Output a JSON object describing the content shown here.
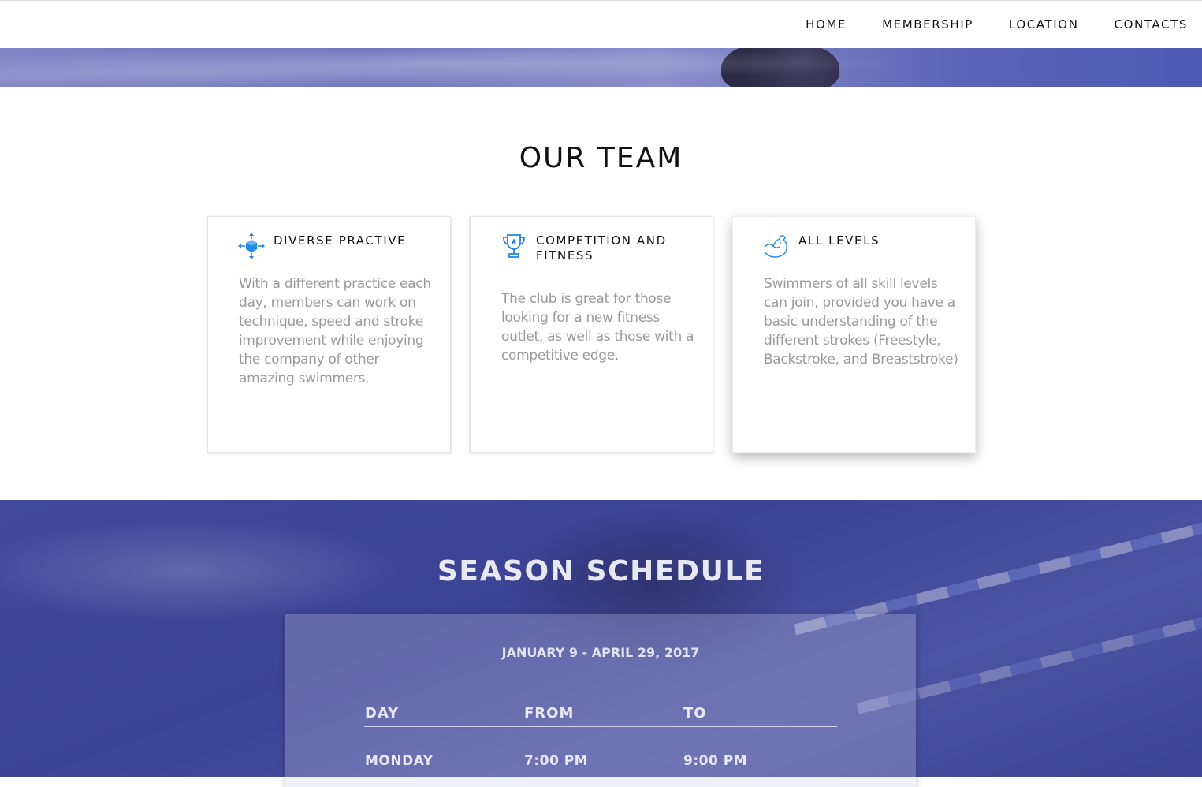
{
  "nav": {
    "items": [
      {
        "label": "HOME"
      },
      {
        "label": "MEMBERSHIP"
      },
      {
        "label": "LOCATION"
      },
      {
        "label": "CONTACTS"
      }
    ]
  },
  "team": {
    "title": "OUR TEAM",
    "cards": [
      {
        "icon": "cube-arrows-icon",
        "title": "DIVERSE PRACTIVE",
        "text": "With a different practice each day, members can work on technique, speed and stroke improvement while enjoying the company of other amazing swimmers."
      },
      {
        "icon": "trophy-icon",
        "title": "COMPETITION AND FITNESS",
        "text": "The club is great for those looking for a new fitness outlet, as well as those with a competitive edge."
      },
      {
        "icon": "flexed-arm-icon",
        "title": "ALL LEVELS",
        "text": "Swimmers of all skill levels can join, provided you have a basic understanding of the different strokes (Freestyle, Backstroke, and Breaststroke)"
      }
    ]
  },
  "schedule": {
    "title": "SEASON SCHEDULE",
    "dates": "JANUARY 9 - APRIL 29, 2017",
    "headers": {
      "day": "DAY",
      "from": "FROM",
      "to": "TO"
    },
    "rows": [
      {
        "day": "MONDAY",
        "from": "7:00 PM",
        "to": "9:00 PM"
      }
    ]
  },
  "colors": {
    "accent": "#1e88e5",
    "schedule_bg": "#3f4799"
  }
}
